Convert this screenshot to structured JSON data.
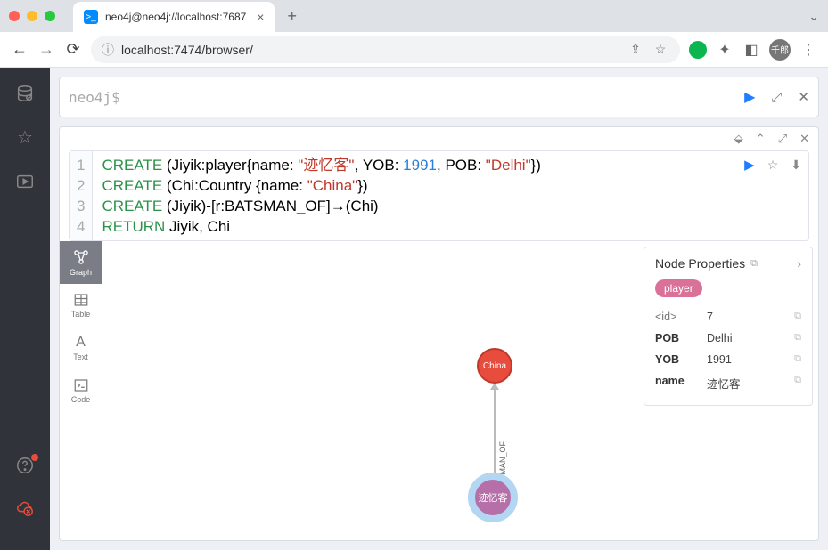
{
  "browser": {
    "tab_title": "neo4j@neo4j://localhost:7687",
    "url": "localhost:7474/browser/",
    "profile": "千郎"
  },
  "editor": {
    "prompt": "neo4j$"
  },
  "code": {
    "lines": [
      "1",
      "2",
      "3",
      "4"
    ],
    "l1": {
      "kw": "CREATE",
      "rest": "(Jiyik:player{name: ",
      "str": "\"迹忆客\"",
      "mid": ", YOB: ",
      "num": "1991",
      "mid2": ", POB: ",
      "str2": "\"Delhi\"",
      "end": "})"
    },
    "l2": {
      "kw": "CREATE",
      "rest": "(Chi:Country {name: ",
      "str": "\"China\"",
      "end": "})"
    },
    "l3": {
      "kw": "CREATE",
      "rest": "(Jiyik)-[r:BATSMAN_OF]→(Chi)"
    },
    "l4": {
      "kw": "RETURN",
      "rest": "Jiyik, Chi"
    }
  },
  "view_tabs": {
    "graph": "Graph",
    "table": "Table",
    "text": "Text",
    "code": "Code"
  },
  "graph": {
    "node_china": "China",
    "node_jiyik": "迹忆客",
    "rel_label": "BATSMAN_OF"
  },
  "props": {
    "title": "Node Properties",
    "label_chip": "player",
    "rows": [
      {
        "k": "<id>",
        "v": "7",
        "light": true
      },
      {
        "k": "POB",
        "v": "Delhi"
      },
      {
        "k": "YOB",
        "v": "1991"
      },
      {
        "k": "name",
        "v": "迹忆客"
      }
    ]
  }
}
